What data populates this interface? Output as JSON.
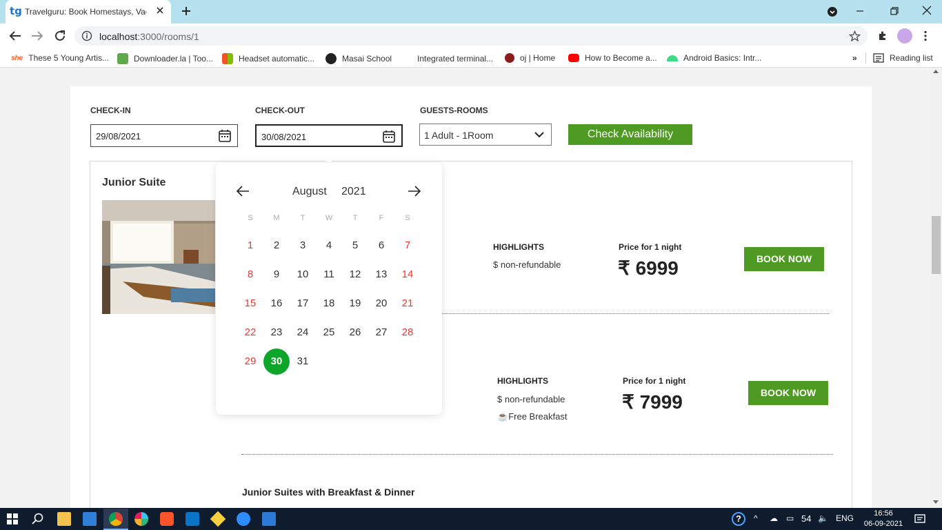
{
  "browser": {
    "tab_logo": "tg",
    "tab_title": "Travelguru: Book Homestays, Vac",
    "url_host": "localhost",
    "url_path": ":3000/rooms/1",
    "bookmarks": [
      {
        "label": "These 5 Young Artis...",
        "color": "#ff5a1f",
        "prefix": "she"
      },
      {
        "label": "Downloader.la | Too...",
        "color": "#5fa94a"
      },
      {
        "label": "Headset automatic...",
        "color": "#f35325"
      },
      {
        "label": "Masai School",
        "color": "#222222"
      },
      {
        "label": "Integrated terminal...",
        "color": "#ffffff"
      },
      {
        "label": "oj | Home",
        "color": "#8b1c1c"
      },
      {
        "label": "How to Become a...",
        "color": "#ff0000"
      },
      {
        "label": "Android Basics: Intr...",
        "color": "#3ddc84"
      }
    ],
    "bookmarks_more": "»",
    "reading_list": "Reading list"
  },
  "search": {
    "checkin_label": "CHECK-IN",
    "checkin_value": "29/08/2021",
    "checkout_label": "CHECK-OUT",
    "checkout_value": "30/08/2021",
    "guests_label": "GUESTS-ROOMS",
    "guests_value": "1 Adult - 1Room",
    "check_button": "Check Availability"
  },
  "calendar": {
    "month": "August",
    "year": "2021",
    "weekdays": [
      "S",
      "M",
      "T",
      "W",
      "T",
      "F",
      "S"
    ],
    "first_weekday": 0,
    "days_in_month": 31,
    "selected_day": 30,
    "colors": {
      "weekend": "#e53935",
      "selected": "#0ea52b"
    }
  },
  "room": {
    "title": "Junior Suite",
    "plans": [
      {
        "highlights_label": "HIGHLIGHTS",
        "highlights": [
          "non-refundable"
        ],
        "price_label": "Price for 1 night",
        "price": "₹ 6999",
        "book_label": "BOOK NOW"
      },
      {
        "highlights_label": "HIGHLIGHTS",
        "highlights": [
          "non-refundable",
          "Free Breakfast"
        ],
        "price_label": "Price for 1 night",
        "price": "₹ 7999",
        "book_label": "BOOK NOW"
      }
    ],
    "next_plan_title": "Junior Suites with Breakfast & Dinner"
  },
  "taskbar": {
    "battery": "54",
    "language": "ENG",
    "time": "16:56",
    "date": "06-09-2021"
  },
  "accent_color": "#4f9a22"
}
